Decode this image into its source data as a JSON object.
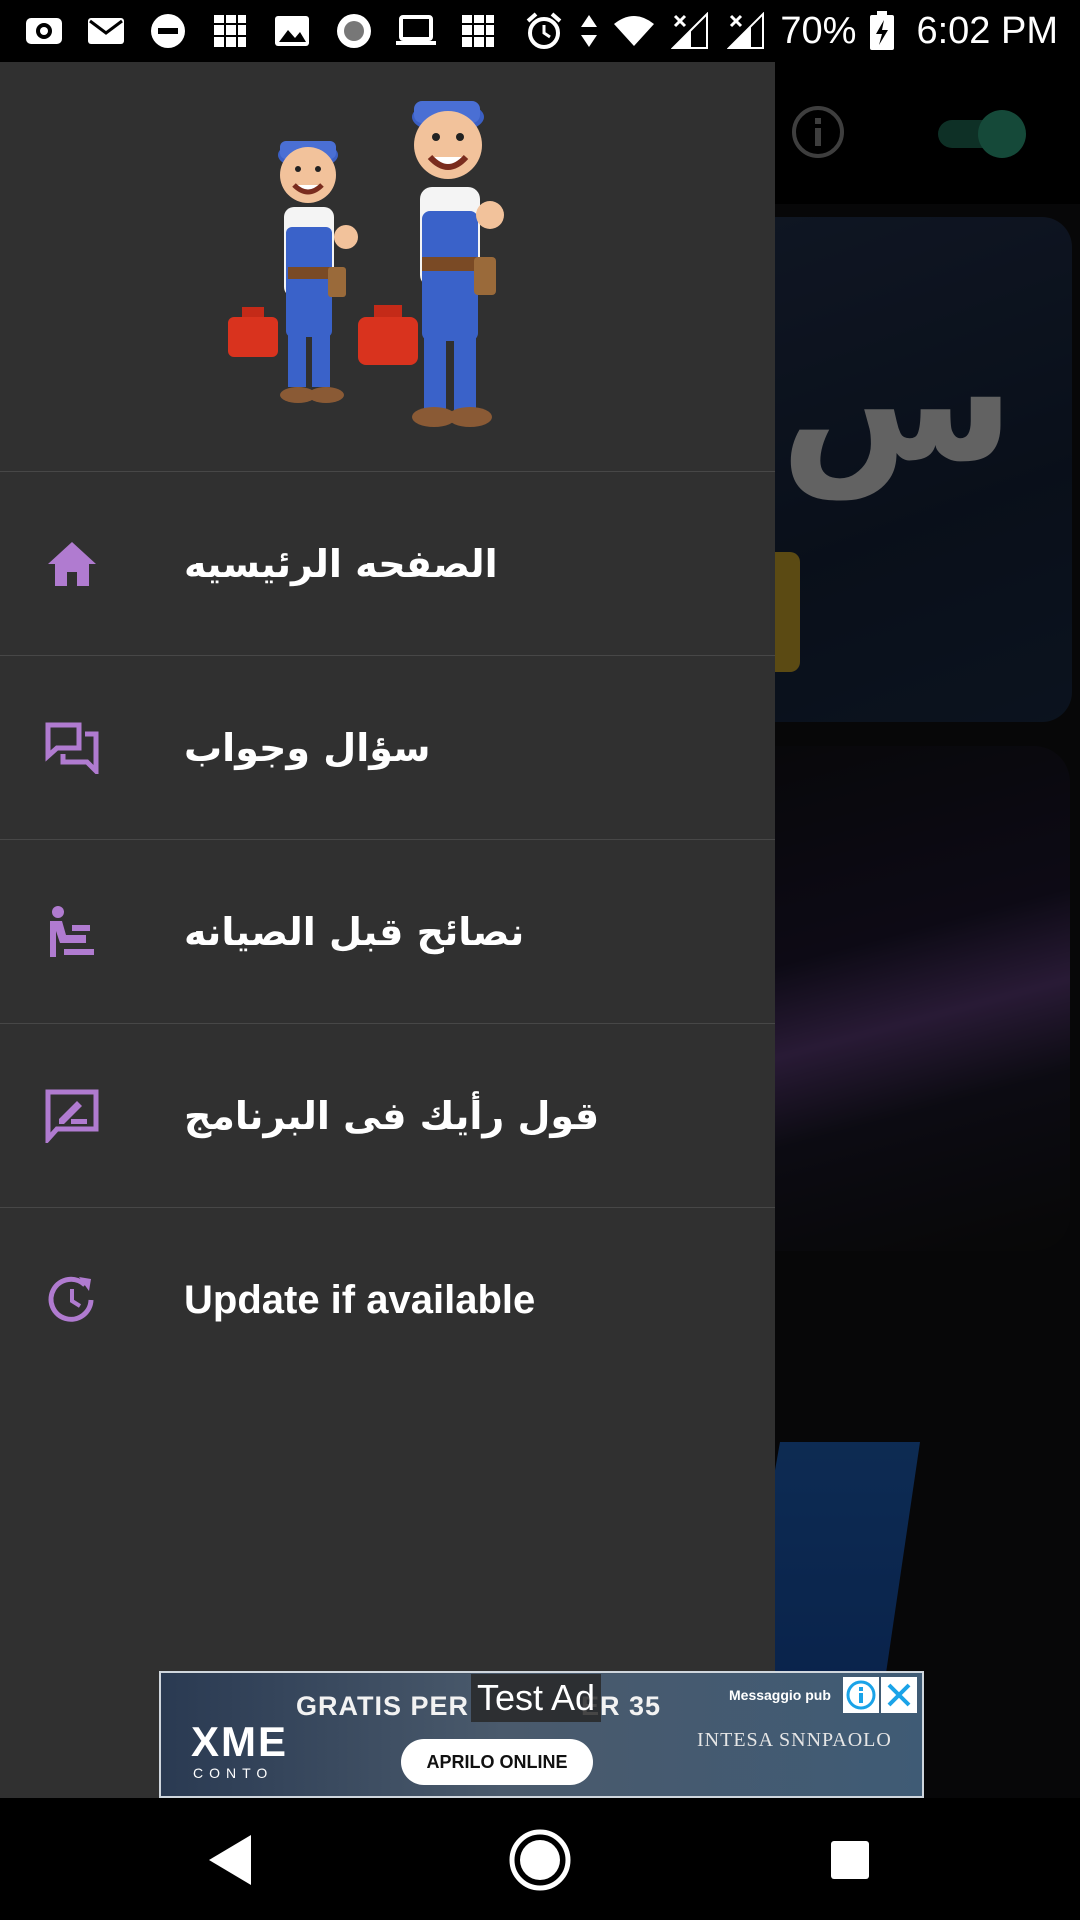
{
  "status_bar": {
    "left_icons": [
      "camera-icon",
      "mail-icon",
      "do-not-disturb-icon",
      "app-icon",
      "image-icon",
      "record-icon",
      "laptop-icon",
      "app-icon"
    ],
    "right_icons": [
      "alarm-icon",
      "data-arrows-icon",
      "wifi-icon",
      "signal-icon",
      "signal-icon",
      "battery-charging-icon"
    ],
    "battery": "70%",
    "time": "6:02 PM"
  },
  "drawer": {
    "header_image": "mechanics-illustration",
    "items": [
      {
        "label": "الصفحه الرئيسيه",
        "icon": "home-icon"
      },
      {
        "label": "سؤال وجواب",
        "icon": "forum-icon"
      },
      {
        "label": "نصائح قبل الصيانه",
        "icon": "spa-icon"
      },
      {
        "label": "قول رأيك فى البرنامج",
        "icon": "rate-review-icon"
      },
      {
        "label": "Update if available",
        "icon": "update-icon"
      }
    ]
  },
  "background": {
    "info_icon": "info-icon",
    "toggle_state": "on",
    "card_text": "س"
  },
  "ad": {
    "test_label": "Test Ad",
    "headline": "GRATIS PER",
    "headline_tail": "ER 35",
    "brand": "XME",
    "brand_sub": "CONTO",
    "cta": "APRILO ONLINE",
    "bank": "INTESA SNNPAOLO",
    "message": "Messaggio pub"
  },
  "colors": {
    "drawer_bg": "#303030",
    "icon_accent": "#b07bd0",
    "toggle_accent": "#2fa27e"
  },
  "nav_bar": {
    "back": "back-icon",
    "home": "home-circle-icon",
    "recents": "recents-icon"
  }
}
